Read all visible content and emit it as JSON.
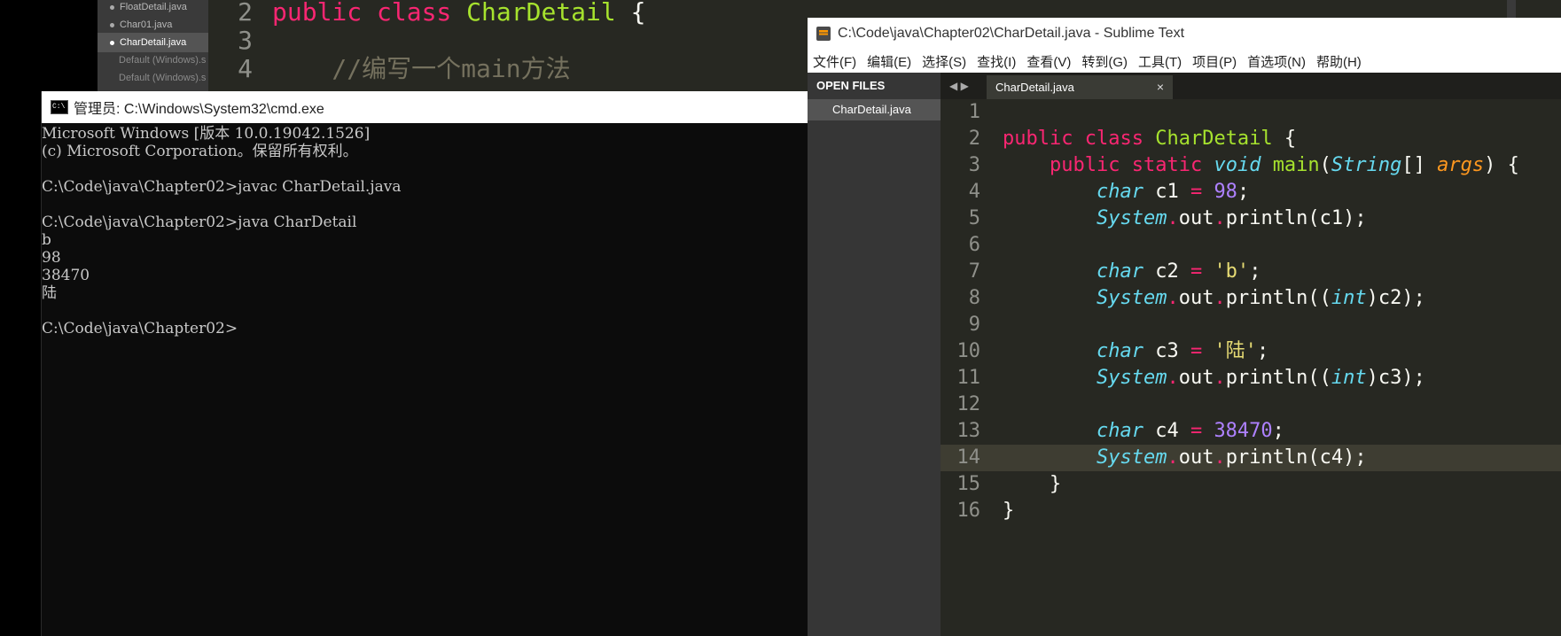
{
  "background_editor": {
    "sidebar_files": [
      {
        "label": "FloatDetail.java",
        "active": false,
        "dot": true
      },
      {
        "label": "Char01.java",
        "active": false,
        "dot": true
      },
      {
        "label": "CharDetail.java",
        "active": true,
        "dot": true
      },
      {
        "label": "Default (Windows).s",
        "active": false,
        "dot": false
      },
      {
        "label": "Default (Windows).s",
        "active": false,
        "dot": false
      }
    ],
    "code_lines": [
      {
        "num": "2",
        "html_kw": "public class ",
        "cls": "CharDetail",
        "rest": " {"
      },
      {
        "num": "3",
        "html_kw": "",
        "cls": "",
        "rest": ""
      },
      {
        "num": "4",
        "html_kw": "",
        "cls": "",
        "rest": "    //编写一个main方法"
      }
    ]
  },
  "cmd": {
    "title": "管理员: C:\\Windows\\System32\\cmd.exe",
    "lines": [
      "Microsoft Windows [版本 10.0.19042.1526]",
      "(c) Microsoft Corporation。保留所有权利。",
      "",
      "C:\\Code\\java\\Chapter02>javac CharDetail.java",
      "",
      "C:\\Code\\java\\Chapter02>java CharDetail",
      "b",
      "98",
      "38470",
      "陆",
      "",
      "C:\\Code\\java\\Chapter02>"
    ]
  },
  "sublime": {
    "title": "C:\\Code\\java\\Chapter02\\CharDetail.java - Sublime Text",
    "menu": [
      "文件(F)",
      "编辑(E)",
      "选择(S)",
      "查找(I)",
      "查看(V)",
      "转到(G)",
      "工具(T)",
      "项目(P)",
      "首选项(N)",
      "帮助(H)"
    ],
    "sidebar_header": "OPEN FILES",
    "open_file": "CharDetail.java",
    "nav_arrows": "◀ ▶",
    "tab_label": "CharDetail.java",
    "tab_close": "×",
    "highlighted_line": 14,
    "code": [
      {
        "n": "1",
        "t": []
      },
      {
        "n": "2",
        "t": [
          [
            "kw",
            "public"
          ],
          [
            "",
            ""
          ],
          [
            "",
            ""
          ],
          [
            "",
            " "
          ],
          [
            "kw",
            "class"
          ],
          [
            "",
            " "
          ],
          [
            "cls",
            "CharDetail"
          ],
          [
            "",
            " {"
          ]
        ]
      },
      {
        "n": "3",
        "t": [
          [
            "",
            "    "
          ],
          [
            "kw",
            "public"
          ],
          [
            "",
            " "
          ],
          [
            "kw",
            "static"
          ],
          [
            "",
            " "
          ],
          [
            "typ",
            "void"
          ],
          [
            "",
            " "
          ],
          [
            "fn",
            "main"
          ],
          [
            "",
            "("
          ],
          [
            "typ",
            "String"
          ],
          [
            "",
            "[] "
          ],
          [
            "arg",
            "args"
          ],
          [
            "",
            ") {"
          ]
        ]
      },
      {
        "n": "4",
        "t": [
          [
            "",
            "        "
          ],
          [
            "typ",
            "char"
          ],
          [
            "",
            " c1 "
          ],
          [
            "kw",
            "="
          ],
          [
            "",
            " "
          ],
          [
            "num",
            "98"
          ],
          [
            "",
            ";"
          ]
        ]
      },
      {
        "n": "5",
        "t": [
          [
            "",
            "        "
          ],
          [
            "typ",
            "System"
          ],
          [
            "kw",
            "."
          ],
          [
            "",
            "out"
          ],
          [
            "kw",
            "."
          ],
          [
            "",
            "println(c1);"
          ]
        ]
      },
      {
        "n": "6",
        "t": []
      },
      {
        "n": "7",
        "t": [
          [
            "",
            "        "
          ],
          [
            "typ",
            "char"
          ],
          [
            "",
            " c2 "
          ],
          [
            "kw",
            "="
          ],
          [
            "",
            " "
          ],
          [
            "str",
            "'b'"
          ],
          [
            "",
            ";"
          ]
        ]
      },
      {
        "n": "8",
        "t": [
          [
            "",
            "        "
          ],
          [
            "typ",
            "System"
          ],
          [
            "kw",
            "."
          ],
          [
            "",
            "out"
          ],
          [
            "kw",
            "."
          ],
          [
            "",
            "println(("
          ],
          [
            "typ",
            "int"
          ],
          [
            "",
            ")c2);"
          ]
        ]
      },
      {
        "n": "9",
        "t": []
      },
      {
        "n": "10",
        "t": [
          [
            "",
            "        "
          ],
          [
            "typ",
            "char"
          ],
          [
            "",
            " c3 "
          ],
          [
            "kw",
            "="
          ],
          [
            "",
            " "
          ],
          [
            "str",
            "'陆'"
          ],
          [
            "",
            ";"
          ]
        ]
      },
      {
        "n": "11",
        "t": [
          [
            "",
            "        "
          ],
          [
            "typ",
            "System"
          ],
          [
            "kw",
            "."
          ],
          [
            "",
            "out"
          ],
          [
            "kw",
            "."
          ],
          [
            "",
            "println(("
          ],
          [
            "typ",
            "int"
          ],
          [
            "",
            ")c3);"
          ]
        ]
      },
      {
        "n": "12",
        "t": []
      },
      {
        "n": "13",
        "t": [
          [
            "",
            "        "
          ],
          [
            "typ",
            "char"
          ],
          [
            "",
            " c4 "
          ],
          [
            "kw",
            "="
          ],
          [
            "",
            " "
          ],
          [
            "num",
            "38470"
          ],
          [
            "",
            ";"
          ]
        ]
      },
      {
        "n": "14",
        "t": [
          [
            "",
            "        "
          ],
          [
            "typ",
            "System"
          ],
          [
            "kw",
            "."
          ],
          [
            "",
            "out"
          ],
          [
            "kw",
            "."
          ],
          [
            "",
            "println(c4);"
          ]
        ]
      },
      {
        "n": "15",
        "t": [
          [
            "",
            "    }"
          ]
        ]
      },
      {
        "n": "16",
        "t": [
          [
            "",
            "}"
          ]
        ]
      }
    ]
  }
}
